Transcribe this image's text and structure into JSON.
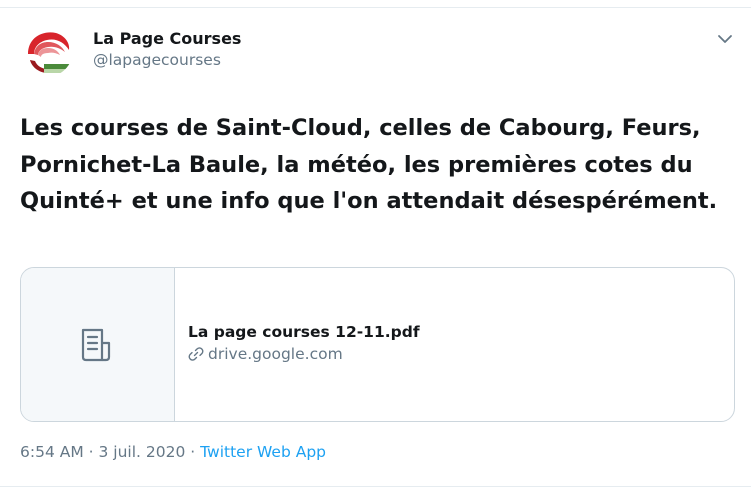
{
  "tweet": {
    "author": {
      "display_name": "La Page Courses",
      "handle": "@lapagecourses",
      "avatar_icon": "red-swirl-logo"
    },
    "text": "Les courses de Saint-Cloud, celles de Cabourg, Feurs, Pornichet-La Baule, la météo, les premières cotes du Quinté+ et une info que l'on attendait désespérément.",
    "card": {
      "title": "La page courses 12-11.pdf",
      "domain": "drive.google.com",
      "thumb_icon": "document-icon",
      "url_icon": "link-icon"
    },
    "meta": {
      "time": "6:54 AM",
      "separator1": " · ",
      "date": "3 juil. 2020",
      "separator2": " · ",
      "source": "Twitter Web App"
    },
    "menu_icon": "chevron-down-icon"
  },
  "colors": {
    "text": "#14171a",
    "secondary": "#657786",
    "accent": "#1da1f2",
    "border": "#ccd6dd",
    "card_thumb_bg": "#f5f8fa"
  }
}
